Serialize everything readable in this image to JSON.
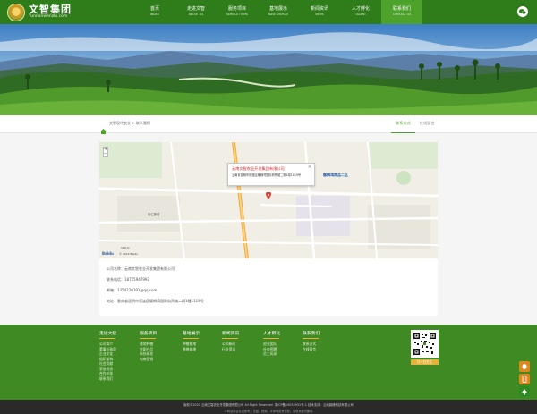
{
  "header": {
    "logo_cn": "文智集团",
    "logo_en": "Yunnanwenzhi.com",
    "nav": [
      {
        "cn": "首页",
        "en": "INDEX"
      },
      {
        "cn": "走进文智",
        "en": "ABOUT US"
      },
      {
        "cn": "服务项目",
        "en": "SERVICE ITEMS"
      },
      {
        "cn": "基地展示",
        "en": "BASE DISPLAY"
      },
      {
        "cn": "新闻资讯",
        "en": "NEWS"
      },
      {
        "cn": "人才孵化",
        "en": "TALENT"
      },
      {
        "cn": "联系我们",
        "en": "CONTACT US"
      }
    ],
    "active_index": 6,
    "accent": "#2e7d1a",
    "active_color": "#4ca22b"
  },
  "breadcrumb": {
    "text": "文智现代农业 > 联系我们",
    "tabs": [
      "联系方式",
      "在线留言"
    ]
  },
  "map": {
    "popup_title": "云南文智农业开发集团有限公司",
    "popup_address": "云南省昆明市官渡区螺蛳湾国际商贸城二期1幢1119号",
    "labels": {
      "district": "螺蛳湾商品二区",
      "town": "彩仁新村",
      "scale": "100 m",
      "baidu": "Baidu",
      "copyright": "© 2019 Baidu"
    }
  },
  "contact": {
    "company": "公司名称：云南文智农业开发集团有限公司",
    "phone": "联系电话：18725947992",
    "email": "邮箱：1354220192@qq.com",
    "address": "地址：云南省昆明市官渡区螺蛳湾国际商贸城二期1幢1119号"
  },
  "footer": {
    "columns": [
      {
        "title": "走进文智",
        "items": [
          "公司简介",
          "董事长致辞",
          "企业文化",
          "组织架构",
          "社会贡献",
          "荣誉资质",
          "合作伙伴",
          "联系我们"
        ]
      },
      {
        "title": "服务项目",
        "items": [
          "基地种植",
          "农副产品",
          "科技研发",
          "电商营销"
        ]
      },
      {
        "title": "基地展示",
        "items": [
          "种植基地",
          "养殖基地"
        ]
      },
      {
        "title": "新闻资讯",
        "items": [
          "公司新闻",
          "行业资讯"
        ]
      },
      {
        "title": "人才孵化",
        "items": [
          "创业团队",
          "社会招聘",
          "员工风采"
        ]
      },
      {
        "title": "联系我们",
        "items": [
          "联系方式",
          "在线留言"
        ]
      }
    ],
    "qr_caption": "扫一扫关注"
  },
  "bottom": {
    "line1": "版权©2022 云南文智农业开发集团有限公司 All Right Reserved.  滇ICP备19032931号-1  技术支持：云南鼎峰科技有限公司",
    "line2": "本网站内容仅供参考，文图、视频、字体等如有侵权，请联系我们删除"
  },
  "icons": [
    "wechat-icon",
    "home-icon",
    "map-pin-icon",
    "qq-icon",
    "phone-icon",
    "wechat-side-icon",
    "back-to-top-icon"
  ]
}
